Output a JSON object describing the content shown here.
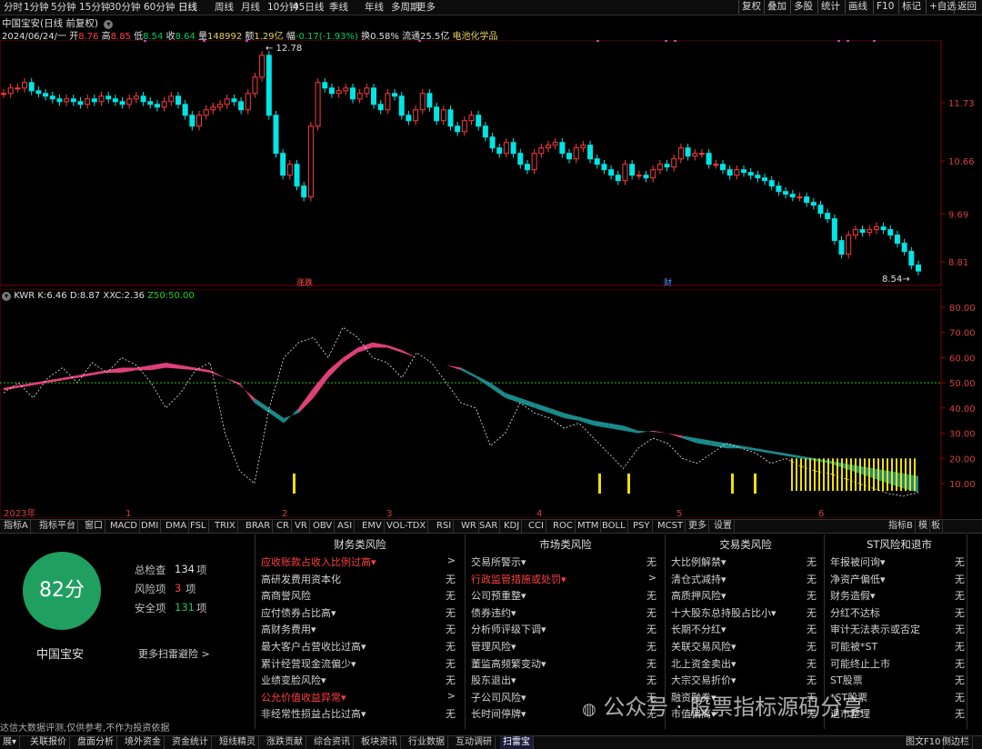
{
  "toolbar": {
    "periods": [
      "分时",
      "1分钟",
      "5分钟",
      "15分钟",
      "30分钟",
      "60分钟",
      "日线",
      "周线",
      "月线",
      "10分钟",
      "45日线",
      "季线",
      "年线",
      "多周期",
      "更多"
    ],
    "active_period": "日线",
    "right_items": [
      "复权",
      "叠加",
      "多股",
      "统计",
      "画线",
      "F10",
      "标记",
      "+自选",
      "返回"
    ]
  },
  "stock": {
    "title": "中国宝安(日线 前复权)",
    "date": "2024/06/24/一",
    "open_label": "开",
    "open": "8.76",
    "high_label": "高",
    "high": "8.85",
    "low_label": "低",
    "low": "8.54",
    "close_label": "收",
    "close": "8.64",
    "volume_label": "量",
    "volume": "148992",
    "amount_label": "额",
    "amount": "1.29亿",
    "change_label": "幅",
    "change": "-0.17(-1.93%)",
    "turnover_label": "换",
    "turnover": "0.58%",
    "float_label": "流通",
    "float": "25.5亿",
    "sector": "电池化学品"
  },
  "price_chart": {
    "y_ticks": [
      "11.73",
      "10.66",
      "9.69",
      "8.81"
    ],
    "max_label": "12.78",
    "min_label": "8.54",
    "event_markers": [
      "涨跌",
      "财"
    ],
    "x_labels": [
      "2023年",
      "1",
      "2",
      "3",
      "4",
      "5",
      "6"
    ]
  },
  "indicator": {
    "name": "KWR",
    "k_label": "K:",
    "k": "6.46",
    "d_label": "D:",
    "d": "8.87",
    "xxc_label": "XXC:",
    "xxc": "2.36",
    "z50_label": "Z50:",
    "z50": "50.00",
    "y_ticks": [
      "80.00",
      "70.00",
      "60.00",
      "50.00",
      "40.00",
      "30.00",
      "20.00",
      "10.00"
    ]
  },
  "indicator_tabs": [
    "指标A",
    "指标平台",
    "窗口",
    "MACD",
    "DMI",
    "DMA",
    "FSL",
    "TRIX",
    "BRAR",
    "CR",
    "VR",
    "OBV",
    "ASI",
    "EMV",
    "VOL-TDX",
    "RSI",
    "WR",
    "SAR",
    "KDJ",
    "CCI",
    "ROC",
    "MTM",
    "BOLL",
    "PSY",
    "MCST",
    "更多",
    "设置"
  ],
  "indicator_tabs_right": [
    "指标B",
    "模",
    "板"
  ],
  "risk": {
    "score": "82分",
    "company": "中国宝安",
    "total_label": "总检查",
    "total": "134",
    "risk_label": "风险项",
    "risk_count": "3",
    "safe_label": "安全项",
    "safe_count": "131",
    "unit": "项",
    "more": "更多扫雷避险 >",
    "columns": [
      {
        "title": "财务类风险",
        "rows": [
          {
            "label": "应收账款占收入比例过高▾",
            "value": ">",
            "warn": true
          },
          {
            "label": "高研发费用资本化",
            "value": "无"
          },
          {
            "label": "高商誉风险",
            "value": "无"
          },
          {
            "label": "应付债券占比高▾",
            "value": "无"
          },
          {
            "label": "高财务费用▾",
            "value": "无"
          },
          {
            "label": "最大客户占营收比过高▾",
            "value": "无"
          },
          {
            "label": "累计经营现金流偏少▾",
            "value": "无"
          },
          {
            "label": "业绩变脸风险▾",
            "value": "无"
          },
          {
            "label": "公允价值收益异常▾",
            "value": ">",
            "warn": true
          },
          {
            "label": "非经常性损益占比过高▾",
            "value": "无"
          }
        ]
      },
      {
        "title": "市场类风险",
        "rows": [
          {
            "label": "交易所警示▾",
            "value": "无"
          },
          {
            "label": "行政监管措施或处罚▾",
            "value": ">",
            "warn": true
          },
          {
            "label": "公司预重整▾",
            "value": "无"
          },
          {
            "label": "债券违约▾",
            "value": "无"
          },
          {
            "label": "分析师评级下调▾",
            "value": "无"
          },
          {
            "label": "管理风险▾",
            "value": "无"
          },
          {
            "label": "董监高频繁变动▾",
            "value": "无"
          },
          {
            "label": "股东退出▾",
            "value": "无"
          },
          {
            "label": "子公司风险▾",
            "value": "无"
          },
          {
            "label": "长时间停牌▾",
            "value": "无"
          }
        ]
      },
      {
        "title": "交易类风险",
        "rows": [
          {
            "label": "大比例解禁▾",
            "value": "无"
          },
          {
            "label": "清仓式减持▾",
            "value": "无"
          },
          {
            "label": "高质押风险▾",
            "value": "无"
          },
          {
            "label": "十大股东总持股占比小▾",
            "value": "无"
          },
          {
            "label": "长期不分红▾",
            "value": "无"
          },
          {
            "label": "关联交易风险▾",
            "value": "无"
          },
          {
            "label": "北上资金卖出▾",
            "value": "无"
          },
          {
            "label": "大宗交易折价▾",
            "value": "无"
          },
          {
            "label": "融资融券▾",
            "value": "无"
          },
          {
            "label": "市值偏离▾",
            "value": "无"
          }
        ]
      },
      {
        "title": "ST风险和退市",
        "rows": [
          {
            "label": "年报被问询▾",
            "value": "无"
          },
          {
            "label": "净资产偏低▾",
            "value": "无"
          },
          {
            "label": "财务造假▾",
            "value": "无"
          },
          {
            "label": "分红不达标",
            "value": "无"
          },
          {
            "label": "审计无法表示或否定",
            "value": "无"
          },
          {
            "label": "可能被*ST",
            "value": "无"
          },
          {
            "label": "可能终止上市",
            "value": "无"
          },
          {
            "label": "ST股票",
            "value": "无"
          },
          {
            "label": "*ST股票",
            "value": "无"
          },
          {
            "label": "退市整理",
            "value": "无"
          }
        ]
      }
    ],
    "disclaimer": "达信大数据评测,仅供参考,不作为投资依据"
  },
  "watermark": "公众号 · 股票指标源码分享",
  "bottom_tabs": [
    "展▾",
    "关联报价",
    "盘面分析",
    "境外资金",
    "资金统计",
    "短线精灵",
    "涨跌贡献",
    "综合资讯",
    "板块资讯",
    "行业数据",
    "互动调研",
    "扫雷宝"
  ],
  "bottom_active": "扫雷宝",
  "bottom_right": [
    "图文F10",
    "侧边栏"
  ],
  "colors": {
    "up": "#ff3c3c",
    "down": "#00e5e5",
    "pink": "#e0407a",
    "teal": "#1a8a8a",
    "yellow": "#f0e000",
    "grid": "#7a0000"
  }
}
